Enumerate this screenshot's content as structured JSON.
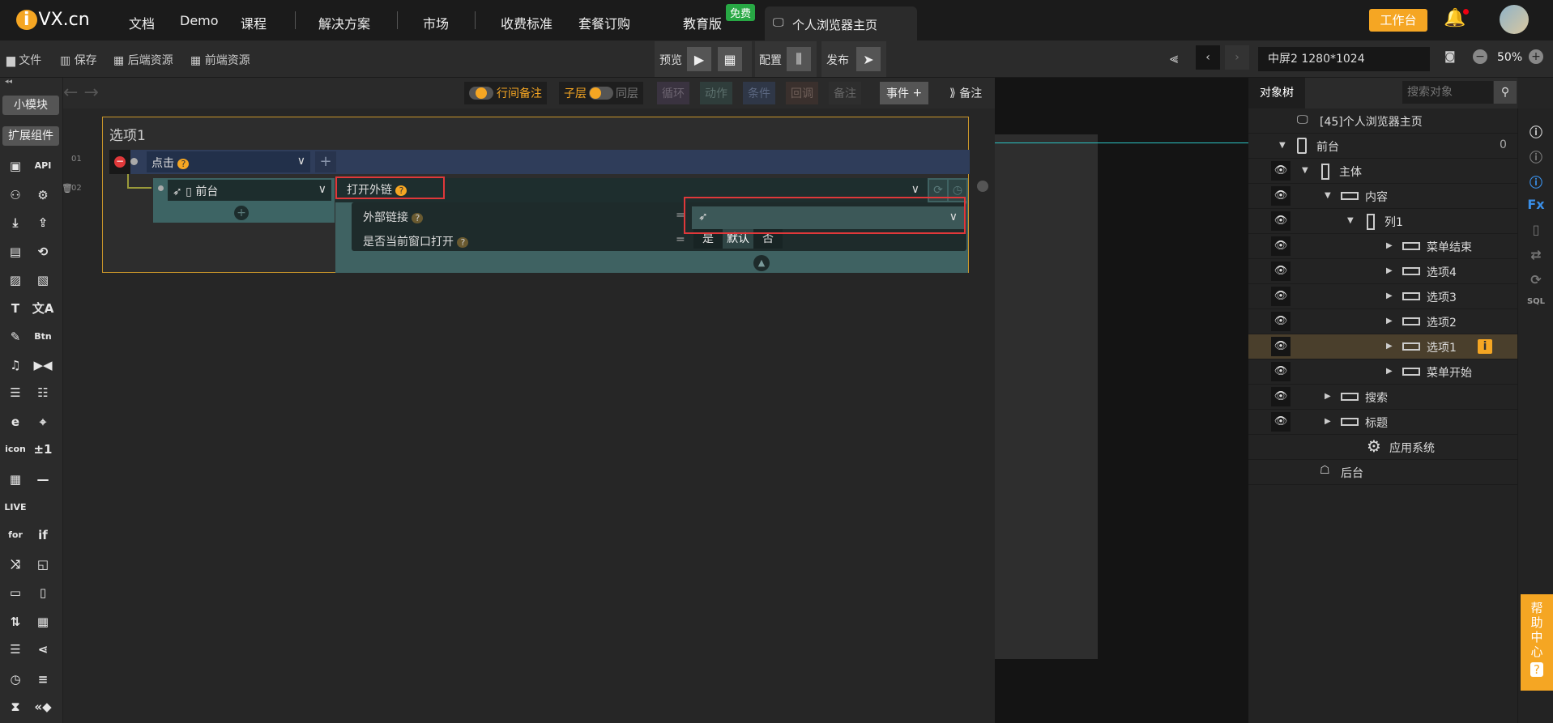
{
  "header": {
    "logo": "iVX.cn",
    "nav": [
      "文档",
      "Demo",
      "课程",
      "解决方案",
      "市场",
      "收费标准",
      "套餐订购",
      "教育版"
    ],
    "free_badge": "免费",
    "tab_title": "个人浏览器主页",
    "workbench": "工作台"
  },
  "toolbar": {
    "file": "文件",
    "save": "保存",
    "backend": "后端资源",
    "frontend": "前端资源",
    "preview": "预览",
    "config": "配置",
    "publish": "发布",
    "screen": "中屏2 1280*1024",
    "zoom": "50%"
  },
  "row3": {
    "inline_note": "行间备注",
    "child": "子层",
    "same": "同层",
    "loop": "循环",
    "action": "动作",
    "condition": "条件",
    "callback": "回调",
    "note": "备注",
    "event": "事件",
    "note_panel": "备注"
  },
  "left": {
    "small_module": "小模块",
    "extend": "扩展组件",
    "icons": [
      [
        "box-icon",
        "▣"
      ],
      [
        "api-icon",
        "API"
      ],
      [
        "network-icon",
        "⚇"
      ],
      [
        "gear-icon",
        "⚙"
      ],
      [
        "download-icon",
        "⤓"
      ],
      [
        "upload-icon",
        "⇪"
      ],
      [
        "window-icon",
        "▤"
      ],
      [
        "rotate-icon",
        "⟲"
      ],
      [
        "image-icon",
        "▨"
      ],
      [
        "images-icon",
        "▧"
      ],
      [
        "text-icon",
        "T"
      ],
      [
        "translate-icon",
        "文A"
      ],
      [
        "edit-icon",
        "✎"
      ],
      [
        "button-icon",
        "Btn"
      ],
      [
        "music-icon",
        "♫"
      ],
      [
        "video-icon",
        "▶◀"
      ],
      [
        "card-icon",
        "☰"
      ],
      [
        "card2-icon",
        "☷"
      ],
      [
        "ie-icon",
        "e"
      ],
      [
        "map-icon",
        "⌖"
      ],
      [
        "icon-icon",
        "icon"
      ],
      [
        "counter-icon",
        "±1"
      ],
      [
        "qr-icon",
        "▦"
      ],
      [
        "line-icon",
        "—"
      ],
      [
        "live-icon",
        "LIVE"
      ],
      [
        "",
        ""
      ],
      [
        "for-icon",
        "for"
      ],
      [
        "if-icon",
        "if"
      ],
      [
        "shuffle-icon",
        "⤨"
      ],
      [
        "layer-icon",
        "◱"
      ],
      [
        "row-icon",
        "▭"
      ],
      [
        "column-icon",
        "▯"
      ],
      [
        "sort-icon",
        "⇅"
      ],
      [
        "table-icon",
        "▦"
      ],
      [
        "tree-icon",
        "☰"
      ],
      [
        "share-icon",
        "⋖"
      ],
      [
        "timer-icon",
        "◷"
      ],
      [
        "sliders-icon",
        "≡"
      ],
      [
        "hourglass-icon",
        "⧗"
      ],
      [
        "diamond-icon",
        "«◆"
      ]
    ]
  },
  "event": {
    "title": "选项1",
    "row1_num": "01",
    "row2_num": "02",
    "trigger": "点击",
    "target": "前台",
    "action": "打开外链",
    "param1": "外部链接",
    "param2": "是否当前窗口打开",
    "opts": [
      "是",
      "默认",
      "否"
    ]
  },
  "tree": {
    "tab": "对象树",
    "search_placeholder": "搜索对象",
    "root": "[45]个人浏览器主页",
    "front_count": "0",
    "items": [
      {
        "label": "前台",
        "depth": 0,
        "eye": false,
        "arrow": "down",
        "icon": "phone"
      },
      {
        "label": "主体",
        "depth": 1,
        "eye": true,
        "arrow": "down",
        "icon": "col"
      },
      {
        "label": "内容",
        "depth": 2,
        "eye": true,
        "arrow": "down",
        "icon": "row"
      },
      {
        "label": "列1",
        "depth": 3,
        "eye": true,
        "arrow": "down",
        "icon": "col"
      },
      {
        "label": "菜单结束",
        "depth": 4,
        "eye": true,
        "arrow": "right",
        "icon": "row"
      },
      {
        "label": "选项4",
        "depth": 4,
        "eye": true,
        "arrow": "right",
        "icon": "row"
      },
      {
        "label": "选项3",
        "depth": 4,
        "eye": true,
        "arrow": "right",
        "icon": "row"
      },
      {
        "label": "选项2",
        "depth": 4,
        "eye": true,
        "arrow": "right",
        "icon": "row"
      },
      {
        "label": "选项1",
        "depth": 4,
        "eye": true,
        "arrow": "right",
        "icon": "row",
        "selected": true
      },
      {
        "label": "菜单开始",
        "depth": 4,
        "eye": true,
        "arrow": "right",
        "icon": "row"
      },
      {
        "label": "搜索",
        "depth": 2,
        "eye": true,
        "arrow": "right",
        "icon": "row"
      },
      {
        "label": "标题",
        "depth": 2,
        "eye": true,
        "arrow": "right",
        "icon": "row"
      },
      {
        "label": "应用系统",
        "depth": 1,
        "eye": false,
        "arrow": "",
        "icon": "gear"
      },
      {
        "label": "后台",
        "depth": 0,
        "eye": false,
        "arrow": "",
        "icon": "server"
      }
    ]
  },
  "help": "帮助中心",
  "colors": {
    "accent": "#f5a623",
    "selected_row": "#4a3f2c",
    "trigger_row": "#2f3d5a",
    "action_bg": "#3f6262",
    "red_highlight": "#e0383a"
  }
}
